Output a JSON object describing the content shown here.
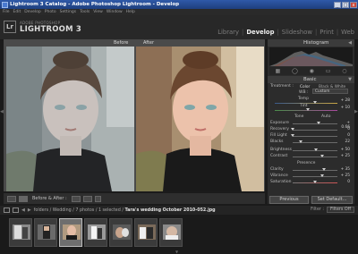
{
  "window": {
    "title": "Lightroom 3 Catalog - Adobe Photoshop Lightroom - Develop",
    "min": "_",
    "max": "□",
    "close": "x"
  },
  "menu": [
    "File",
    "Edit",
    "Develop",
    "Photo",
    "Settings",
    "Tools",
    "View",
    "Window",
    "Help"
  ],
  "brand": {
    "badge": "Lr",
    "small": "ADOBE PHOTOSHOP",
    "big": "LIGHTROOM 3"
  },
  "modules": {
    "items": [
      "Library",
      "Develop",
      "Slideshow",
      "Print",
      "Web"
    ],
    "active": "Develop",
    "separator": "|"
  },
  "preview": {
    "before_label": "Before",
    "after_label": "After"
  },
  "toolbar": {
    "before_after_label": "Before & After :"
  },
  "panel": {
    "histogram_title": "Histogram",
    "basic_title": "Basic",
    "treatment_label": "Treatment :",
    "color_label": "Color",
    "bw_label": "Black & White",
    "wb_label": "WB :",
    "wb_value": "Custom",
    "temp_label": "Temp",
    "temp_value": "+ 28",
    "tint_label": "Tint",
    "tint_value": "+ 10",
    "tone_label": "Tone",
    "auto_label": "Auto",
    "exposure_label": "Exposure",
    "exposure_value": "+ 0.66",
    "recovery_label": "Recovery",
    "recovery_value": "0",
    "fill_label": "Fill Light",
    "fill_value": "0",
    "blacks_label": "Blacks",
    "blacks_value": "22",
    "brightness_label": "Brightness",
    "brightness_value": "+ 50",
    "contrast_label": "Contrast",
    "contrast_value": "+ 25",
    "presence_label": "Presence",
    "clarity_label": "Clarity",
    "clarity_value": "+ 35",
    "vibrance_label": "Vibrance",
    "vibrance_value": "+ 25",
    "saturation_label": "Saturation",
    "saturation_value": "0",
    "previous_button": "Previous",
    "set_default_button": "Set Default..."
  },
  "filmstrip_nav": {
    "path_prefix": "folders / Wedding / 7 photos / 1 selected /",
    "file_name": "Tara's wedding October 2010-052.jpg",
    "filter_label": "Filter :",
    "filter_value": "Filters Off"
  },
  "colors": {
    "title_bar": "#2f59a8",
    "panel_bg": "#2c2c2c",
    "active_module": "#f0f0f0"
  },
  "icons": [
    "lr-badge",
    "crop-icon",
    "spot-removal-icon",
    "red-eye-icon",
    "graduated-filter-icon",
    "adjustment-brush-icon",
    "grid-view-icon",
    "loupe-view-icon"
  ]
}
